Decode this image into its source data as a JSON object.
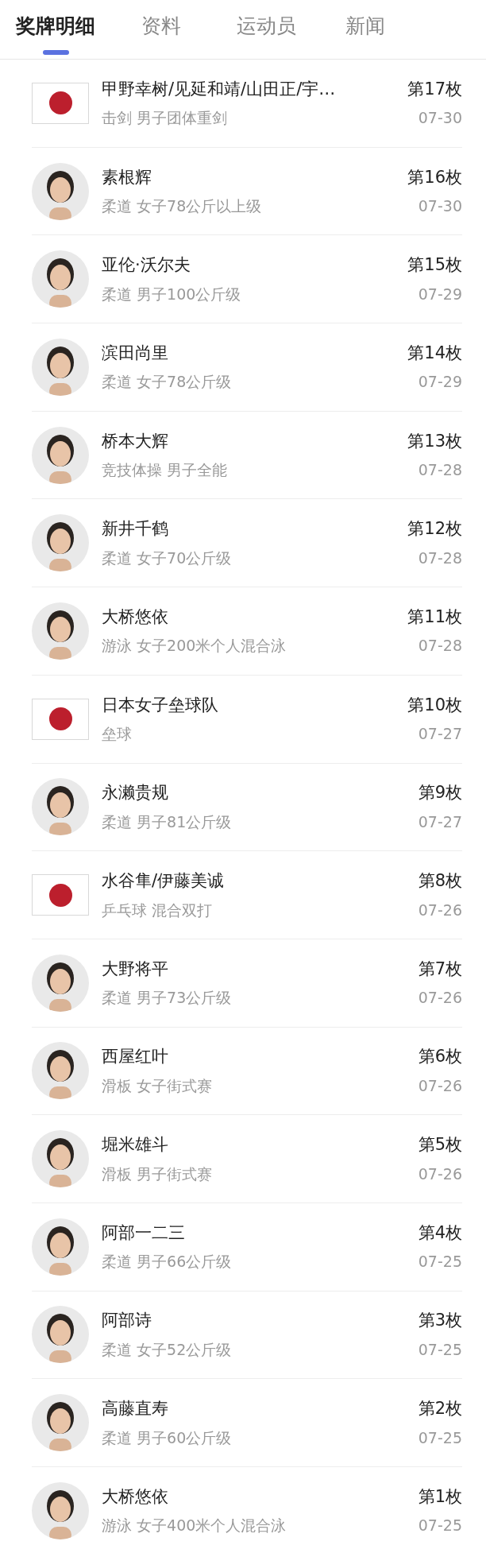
{
  "tabs": [
    {
      "label": "奖牌明细",
      "selected": true
    },
    {
      "label": "资料",
      "selected": false
    },
    {
      "label": "运动员",
      "selected": false
    },
    {
      "label": "新闻",
      "selected": false
    }
  ],
  "medals": [
    {
      "kind": "flag",
      "name": "甲野幸树/见延和靖/山田正/宇…",
      "event": "击剑 男子团体重剑",
      "medal": "第17枚",
      "date": "07-30"
    },
    {
      "kind": "person",
      "name": "素根辉",
      "event": "柔道 女子78公斤以上级",
      "medal": "第16枚",
      "date": "07-30"
    },
    {
      "kind": "person",
      "name": "亚伦·沃尔夫",
      "event": "柔道 男子100公斤级",
      "medal": "第15枚",
      "date": "07-29"
    },
    {
      "kind": "person",
      "name": "滨田尚里",
      "event": "柔道 女子78公斤级",
      "medal": "第14枚",
      "date": "07-29"
    },
    {
      "kind": "person",
      "name": "桥本大辉",
      "event": "竞技体操 男子全能",
      "medal": "第13枚",
      "date": "07-28"
    },
    {
      "kind": "person",
      "name": "新井千鹤",
      "event": "柔道 女子70公斤级",
      "medal": "第12枚",
      "date": "07-28"
    },
    {
      "kind": "person",
      "name": "大桥悠依",
      "event": "游泳 女子200米个人混合泳",
      "medal": "第11枚",
      "date": "07-28"
    },
    {
      "kind": "flag",
      "name": "日本女子垒球队",
      "event": "垒球",
      "medal": "第10枚",
      "date": "07-27"
    },
    {
      "kind": "person",
      "name": "永濑贵规",
      "event": "柔道 男子81公斤级",
      "medal": "第9枚",
      "date": "07-27"
    },
    {
      "kind": "flag",
      "name": "水谷隼/伊藤美诚",
      "event": "乒乓球 混合双打",
      "medal": "第8枚",
      "date": "07-26"
    },
    {
      "kind": "person",
      "name": "大野将平",
      "event": "柔道 男子73公斤级",
      "medal": "第7枚",
      "date": "07-26"
    },
    {
      "kind": "person",
      "name": "西屋红叶",
      "event": "滑板 女子街式赛",
      "medal": "第6枚",
      "date": "07-26"
    },
    {
      "kind": "person",
      "name": "堀米雄斗",
      "event": "滑板 男子街式赛",
      "medal": "第5枚",
      "date": "07-26"
    },
    {
      "kind": "person",
      "name": "阿部一二三",
      "event": "柔道 男子66公斤级",
      "medal": "第4枚",
      "date": "07-25"
    },
    {
      "kind": "person",
      "name": "阿部诗",
      "event": "柔道 女子52公斤级",
      "medal": "第3枚",
      "date": "07-25"
    },
    {
      "kind": "person",
      "name": "高藤直寿",
      "event": "柔道 男子60公斤级",
      "medal": "第2枚",
      "date": "07-25"
    },
    {
      "kind": "person",
      "name": "大桥悠依",
      "event": "游泳 女子400米个人混合泳",
      "medal": "第1枚",
      "date": "07-25"
    }
  ]
}
